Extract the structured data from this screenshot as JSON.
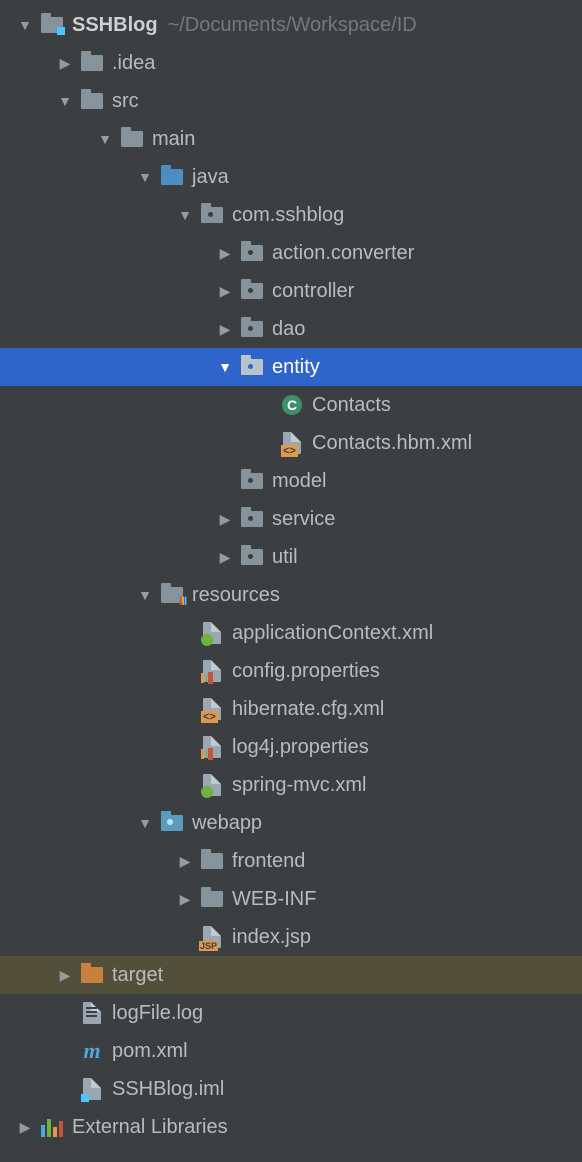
{
  "project": {
    "name": "SSHBlog",
    "path": "~/Documents/Workspace/ID"
  },
  "tree": {
    "idea": ".idea",
    "src": "src",
    "main": "main",
    "java": "java",
    "pkg": "com.sshblog",
    "actionconv": "action.converter",
    "controller": "controller",
    "dao": "dao",
    "entity": "entity",
    "contacts": "Contacts",
    "contacts_hbm": "Contacts.hbm.xml",
    "model": "model",
    "service": "service",
    "util": "util",
    "resources": "resources",
    "appctx": "applicationContext.xml",
    "configprop": "config.properties",
    "hibcfg": "hibernate.cfg.xml",
    "log4j": "log4j.properties",
    "springmvc": "spring-mvc.xml",
    "webapp": "webapp",
    "frontend": "frontend",
    "webinf": "WEB-INF",
    "indexjsp": "index.jsp",
    "target": "target",
    "logfile": "logFile.log",
    "pom": "pom.xml",
    "iml": "SSHBlog.iml",
    "extlibs": "External Libraries"
  }
}
